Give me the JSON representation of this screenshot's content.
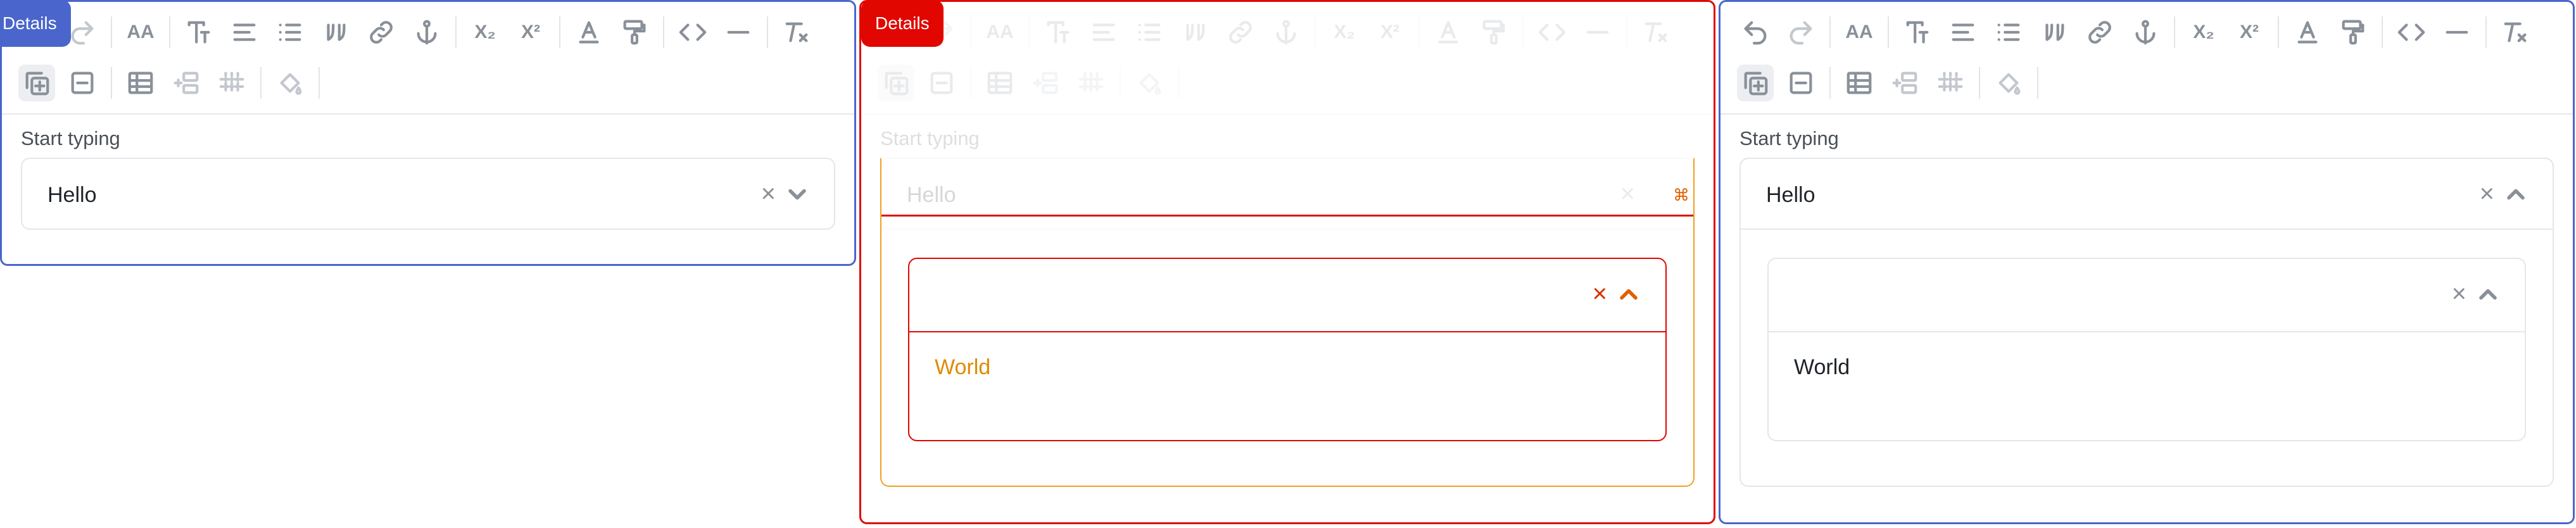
{
  "tooltips": [
    {
      "label": "Details"
    },
    {
      "label": "Details"
    }
  ],
  "toolbar": {
    "row1": [
      "undo-icon",
      "redo-icon",
      "font-size-icon",
      "text-style-icon",
      "align-icon",
      "bullet-list-icon",
      "blockquote-icon",
      "link-icon",
      "anchor-icon",
      "subscript-icon",
      "superscript-icon",
      "font-color-icon",
      "format-painter-icon",
      "code-icon",
      "horizontal-rule-icon",
      "clear-format-icon"
    ],
    "row2": [
      "add-details-icon",
      "remove-details-icon",
      "table-icon",
      "add-row-icon",
      "delete-table-icon",
      "cell-color-icon"
    ],
    "font_size_text": "AA",
    "subscript_text": "X₂",
    "superscript_text": "X²"
  },
  "panels": [
    {
      "label": "Start typing",
      "select_value": "Hello",
      "expanded": false
    },
    {
      "label": "Start typing",
      "select_value": "Hello",
      "expanded": true,
      "inner_option": "World"
    },
    {
      "label": "Start typing",
      "select_value": "Hello",
      "expanded": true,
      "inner_option": "World"
    }
  ],
  "colors": {
    "panel_border": "#4a66cc",
    "highlight_border": "#e10600",
    "highlight_accent": "#f0a020",
    "icon_gray": "#8a9099"
  }
}
